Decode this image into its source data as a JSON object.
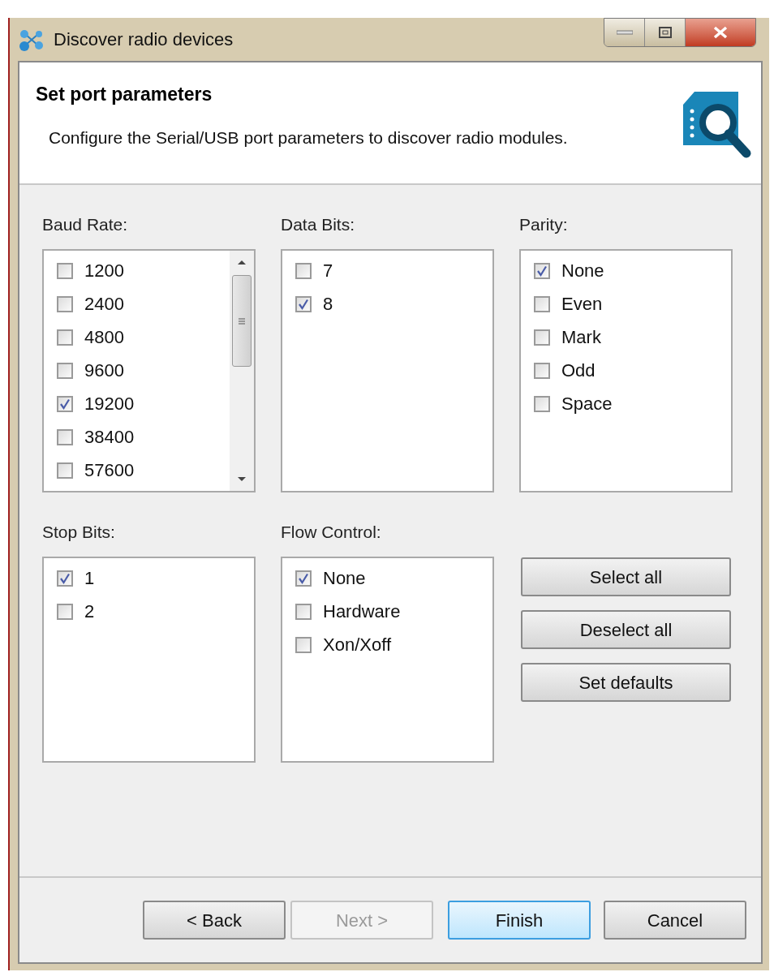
{
  "window": {
    "title": "Discover radio devices"
  },
  "header": {
    "title": "Set port parameters",
    "description": "Configure the Serial/USB port parameters to discover radio modules."
  },
  "groups": [
    {
      "label": "Baud Rate:",
      "scrollable": true,
      "items": [
        {
          "label": "1200",
          "checked": false
        },
        {
          "label": "2400",
          "checked": false
        },
        {
          "label": "4800",
          "checked": false
        },
        {
          "label": "9600",
          "checked": false
        },
        {
          "label": "19200",
          "checked": true
        },
        {
          "label": "38400",
          "checked": false
        },
        {
          "label": "57600",
          "checked": false
        }
      ]
    },
    {
      "label": "Data Bits:",
      "scrollable": false,
      "items": [
        {
          "label": "7",
          "checked": false
        },
        {
          "label": "8",
          "checked": true
        }
      ]
    },
    {
      "label": "Parity:",
      "scrollable": false,
      "items": [
        {
          "label": "None",
          "checked": true
        },
        {
          "label": "Even",
          "checked": false
        },
        {
          "label": "Mark",
          "checked": false
        },
        {
          "label": "Odd",
          "checked": false
        },
        {
          "label": "Space",
          "checked": false
        }
      ]
    },
    {
      "label": "Stop Bits:",
      "scrollable": false,
      "items": [
        {
          "label": "1",
          "checked": true
        },
        {
          "label": "2",
          "checked": false
        }
      ]
    },
    {
      "label": "Flow Control:",
      "scrollable": false,
      "items": [
        {
          "label": "None",
          "checked": true
        },
        {
          "label": "Hardware",
          "checked": false
        },
        {
          "label": "Xon/Xoff",
          "checked": false
        }
      ]
    }
  ],
  "side_buttons": [
    "Select all",
    "Deselect all",
    "Set defaults"
  ],
  "footer_buttons": [
    {
      "label": "< Back",
      "disabled": false,
      "default": false
    },
    {
      "label": "Next >",
      "disabled": true,
      "default": false
    },
    {
      "label": "Finish",
      "disabled": false,
      "default": true
    },
    {
      "label": "Cancel",
      "disabled": false,
      "default": false
    }
  ]
}
